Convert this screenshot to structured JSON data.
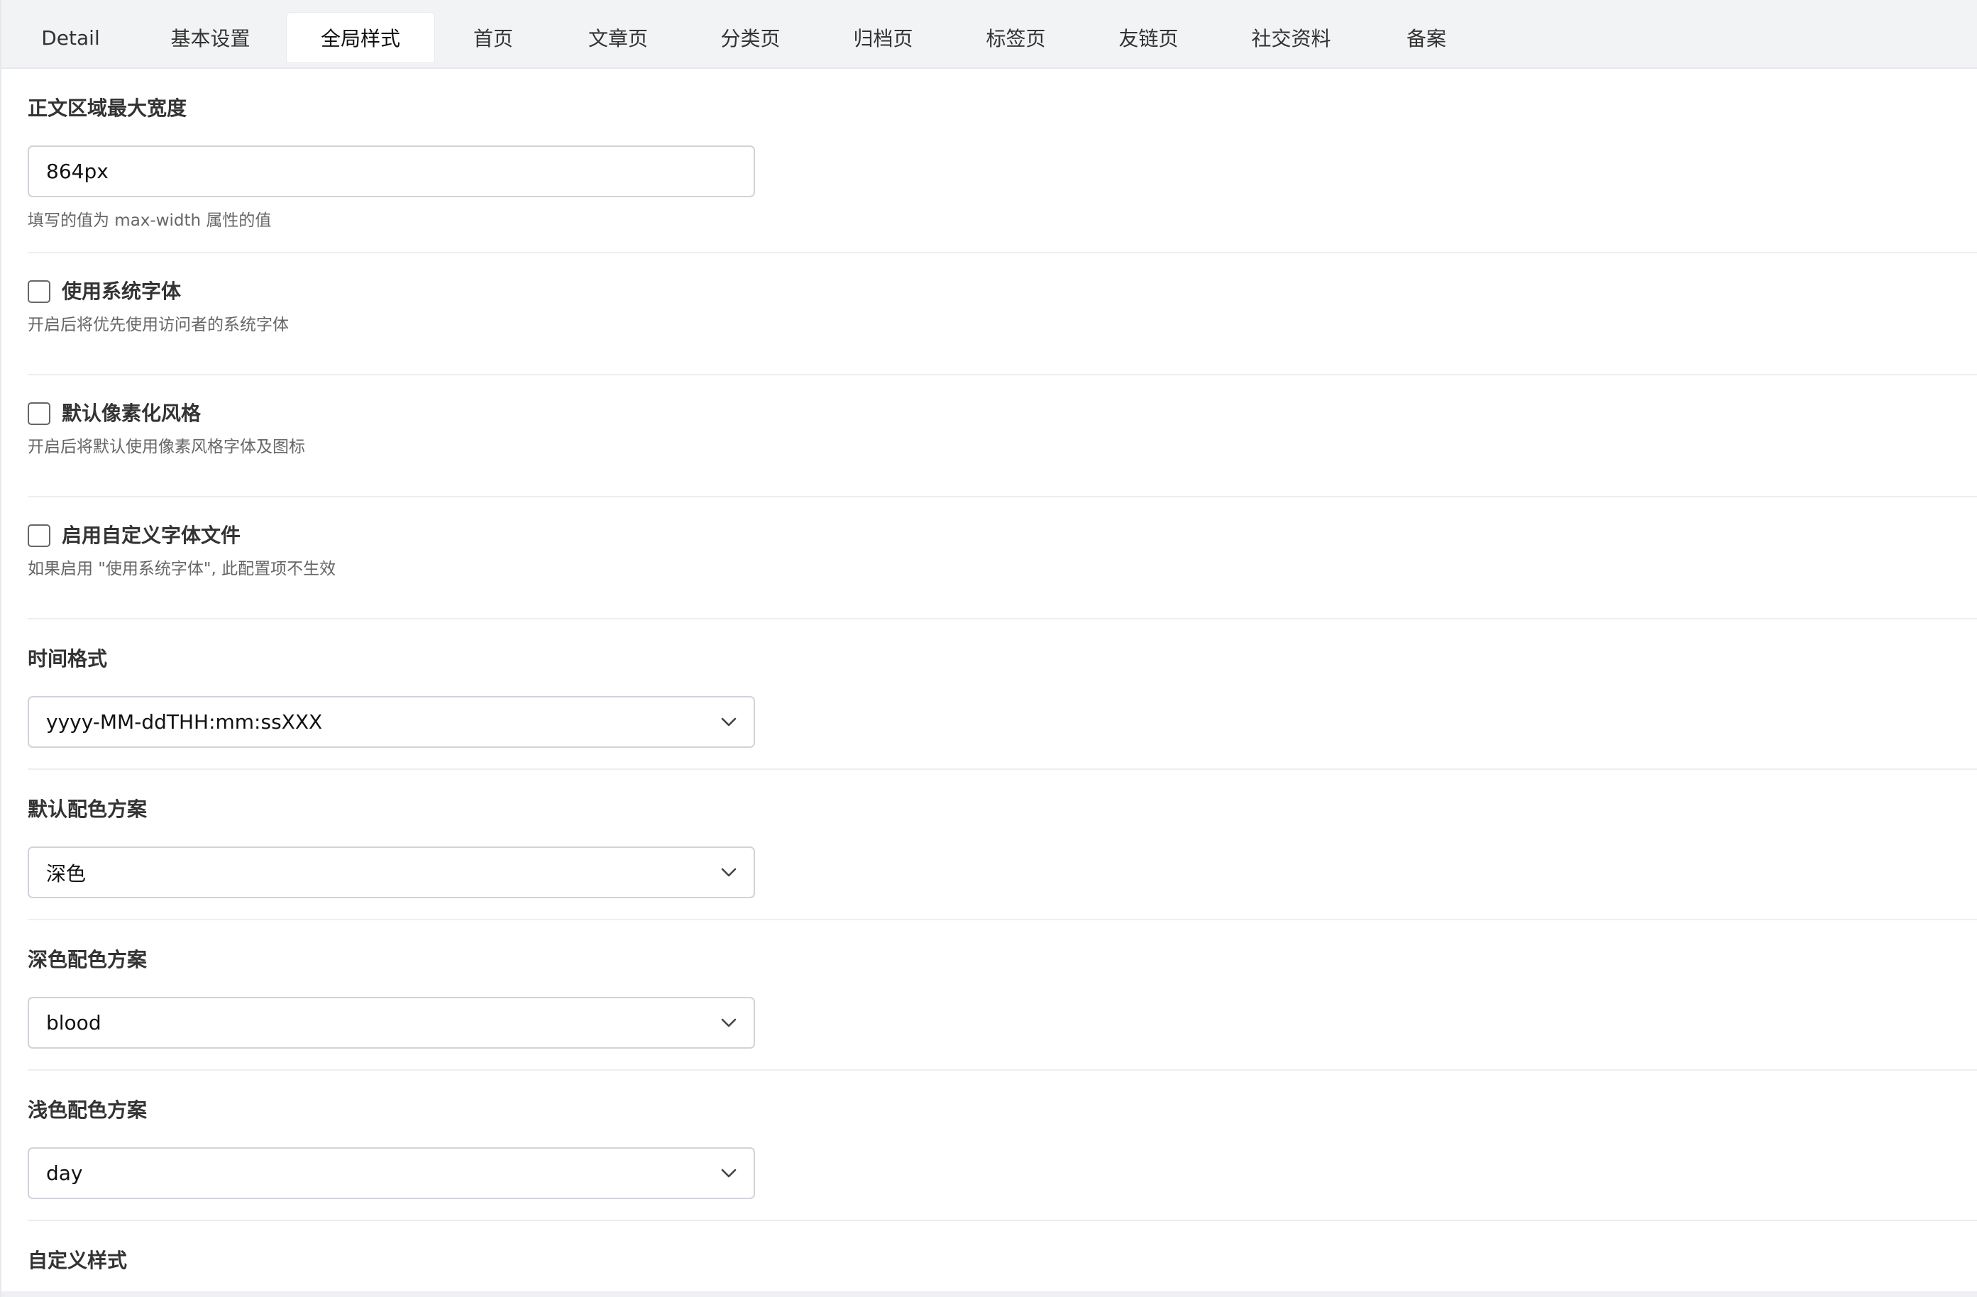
{
  "tabs": [
    {
      "label": "Detail",
      "active": false
    },
    {
      "label": "基本设置",
      "active": false
    },
    {
      "label": "全局样式",
      "active": true
    },
    {
      "label": "首页",
      "active": false
    },
    {
      "label": "文章页",
      "active": false
    },
    {
      "label": "分类页",
      "active": false
    },
    {
      "label": "归档页",
      "active": false
    },
    {
      "label": "标签页",
      "active": false
    },
    {
      "label": "友链页",
      "active": false
    },
    {
      "label": "社交资料",
      "active": false
    },
    {
      "label": "备案",
      "active": false
    }
  ],
  "fields": {
    "max_width": {
      "label": "正文区域最大宽度",
      "value": "864px",
      "hint": "填写的值为 max-width 属性的值"
    },
    "system_font": {
      "label": "使用系统字体",
      "checked": false,
      "hint": "开启后将优先使用访问者的系统字体"
    },
    "pixel_style": {
      "label": "默认像素化风格",
      "checked": false,
      "hint": "开启后将默认使用像素风格字体及图标"
    },
    "custom_font": {
      "label": "启用自定义字体文件",
      "checked": false,
      "hint": "如果启用 \"使用系统字体\", 此配置项不生效"
    },
    "time_format": {
      "label": "时间格式",
      "value": "yyyy-MM-ddTHH:mm:ssXXX"
    },
    "default_scheme": {
      "label": "默认配色方案",
      "value": "深色"
    },
    "dark_scheme": {
      "label": "深色配色方案",
      "value": "blood"
    },
    "light_scheme": {
      "label": "浅色配色方案",
      "value": "day"
    },
    "custom_style": {
      "label": "自定义样式"
    }
  },
  "icons": {
    "select_arrow": "chevron-down-icon"
  }
}
